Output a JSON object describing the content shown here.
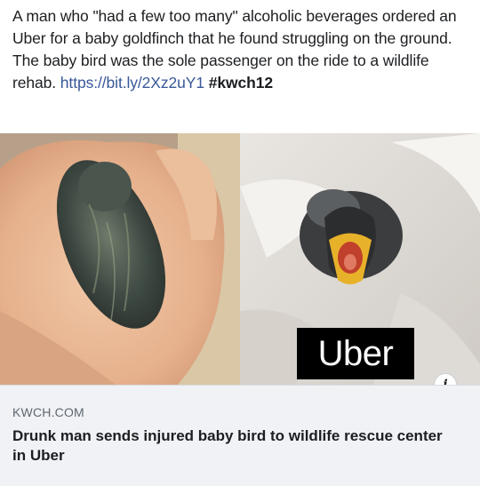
{
  "post": {
    "text": "A man who \"had a few too many\" alcoholic beverages ordered an Uber for a baby goldfinch that he found struggling on the ground. The baby bird was the sole passenger on the ride to a wildlife rehab. ",
    "link": "https://bit.ly/2Xz2uY1",
    "hashtag": "#kwch12"
  },
  "media": {
    "overlay_logo_text": "Uber",
    "info_icon": "info-icon",
    "info_glyph": "i"
  },
  "link_card": {
    "source": "KWCH.COM",
    "headline": "Drunk man sends injured baby bird to wildlife rescue center in Uber"
  }
}
